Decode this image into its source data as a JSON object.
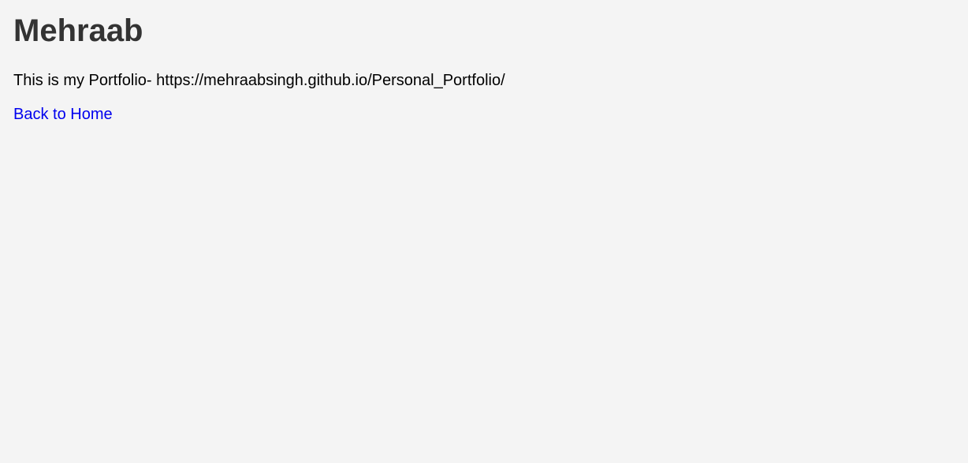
{
  "page": {
    "title": "Mehraab",
    "intro_text": "This is my Portfolio- https://mehraabsingh.github.io/Personal_Portfolio/",
    "back_link_label": "Back to Home"
  },
  "colors": {
    "background": "#f4f4f4",
    "heading": "#333333",
    "text": "#000000",
    "link": "#0000ee"
  }
}
